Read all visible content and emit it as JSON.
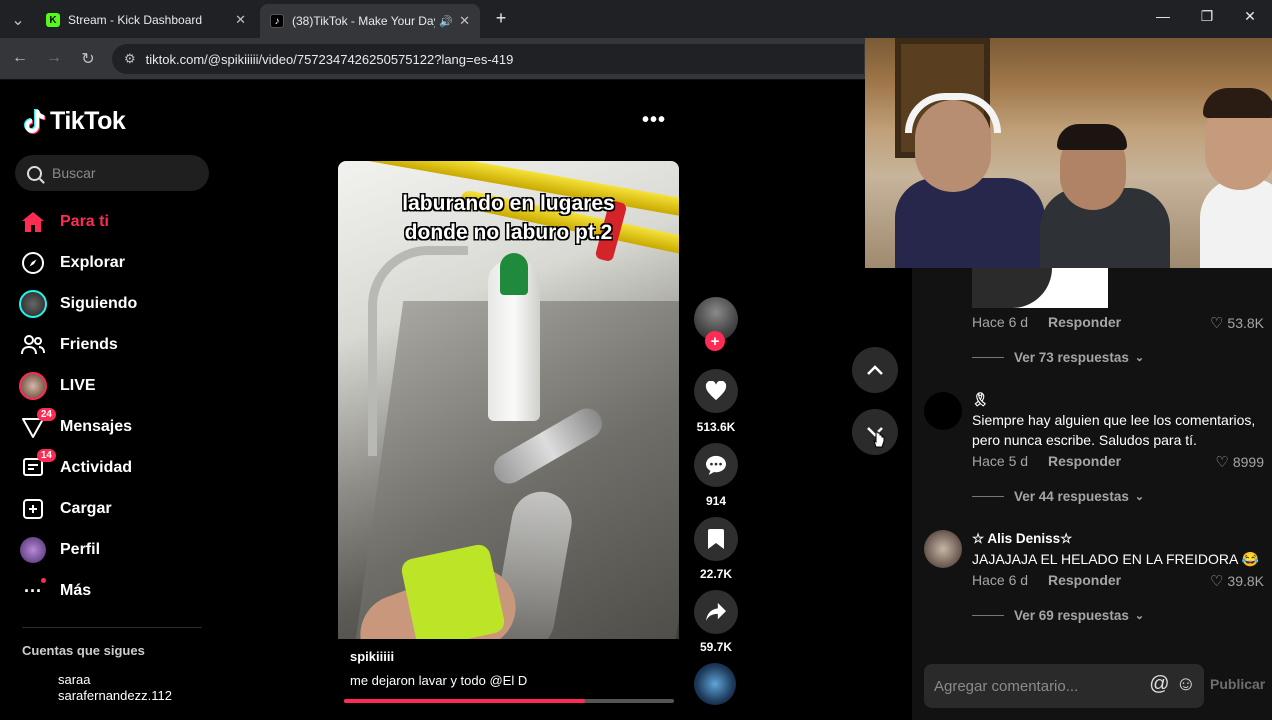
{
  "browser": {
    "tabs": [
      {
        "title": "Stream - Kick Dashboard",
        "favicon_letter": "K",
        "favicon_color": "#53fc18",
        "active": false
      },
      {
        "title": "(38)TikTok - Make Your Day",
        "favicon_letter": "♪",
        "favicon_color": "#000000",
        "active": true
      }
    ],
    "new_tab": "+",
    "url": "tiktok.com/@spikiiiii/video/7572347426250575122?lang=es-419",
    "window_controls": {
      "minimize": "—",
      "restore": "❐",
      "close": "✕"
    }
  },
  "sidebar": {
    "logo_text": "TikTok",
    "search_placeholder": "Buscar",
    "items": [
      {
        "label": "Para ti",
        "icon": "home-icon",
        "glyph": "⌂",
        "active": true
      },
      {
        "label": "Explorar",
        "icon": "compass-icon",
        "glyph": "◎",
        "active": false
      },
      {
        "label": "Siguiendo",
        "icon": "following-avatar-icon",
        "glyph": "◉",
        "active": false
      },
      {
        "label": "Friends",
        "icon": "friends-icon",
        "glyph": "👥",
        "active": false
      },
      {
        "label": "LIVE",
        "icon": "live-icon",
        "glyph": "◉",
        "active": false
      },
      {
        "label": "Mensajes",
        "icon": "messages-icon",
        "glyph": "▽",
        "badge": "24",
        "active": false
      },
      {
        "label": "Actividad",
        "icon": "activity-icon",
        "glyph": "☐",
        "badge": "14",
        "active": false
      },
      {
        "label": "Cargar",
        "icon": "upload-icon",
        "glyph": "⊞",
        "active": false
      },
      {
        "label": "Perfil",
        "icon": "profile-icon",
        "glyph": "●",
        "active": false
      },
      {
        "label": "Más",
        "icon": "more-icon",
        "glyph": "···",
        "active": false
      }
    ],
    "following_title": "Cuentas que sigues",
    "following_accounts": [
      {
        "name": "saraa",
        "handle": "sarafernandezz.112"
      }
    ]
  },
  "video": {
    "overlay_text_line1": "laburando en lugares",
    "overlay_text_line2": "donde no laburo pt.2",
    "author": "spikiiiii",
    "description": "me dejaron lavar y todo @El D",
    "progress": 0.73
  },
  "actions": {
    "likes": "513.6K",
    "comments": "914",
    "saves": "22.7K",
    "shares": "59.7K"
  },
  "comments": {
    "first_meta": {
      "date": "Hace 6 d",
      "reply": "Responder",
      "likes": "53.8K"
    },
    "first_view_replies": "Ver 73 respuestas",
    "list": [
      {
        "user": "🎗",
        "text": "Siempre hay alguien que lee los comentarios, pero nunca escribe. Saludos para tí.",
        "date": "Hace 5 d",
        "reply": "Responder",
        "likes": "8999",
        "view_replies": "Ver 44 respuestas"
      },
      {
        "user": "☆ Alis Deniss☆",
        "text": "JAJAJAJA EL HELADO EN LA FREIDORA 😂",
        "date": "Hace 6 d",
        "reply": "Responder",
        "likes": "39.8K",
        "view_replies": "Ver 69 respuestas"
      }
    ],
    "input_placeholder": "Agregar comentario...",
    "publish_label": "Publicar"
  },
  "colors": {
    "accent": "#fe2c55",
    "bg": "#000000",
    "panel": "#121212"
  }
}
